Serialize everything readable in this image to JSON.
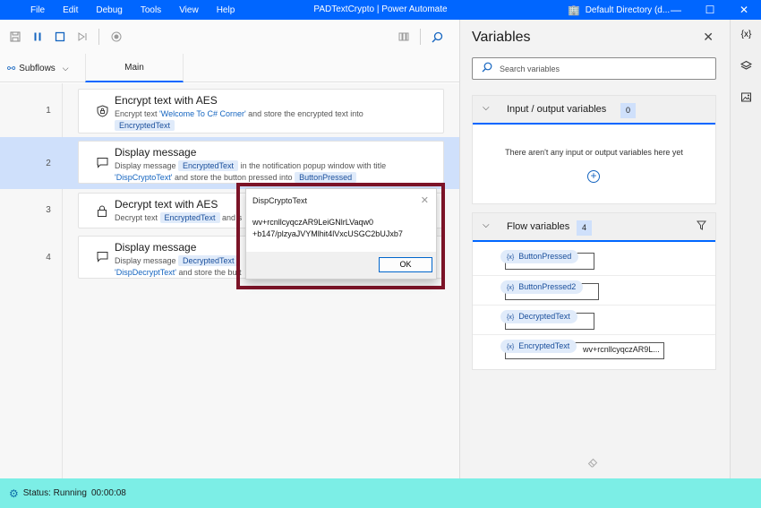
{
  "titlebar": {
    "menu": [
      "File",
      "Edit",
      "Debug",
      "Tools",
      "View",
      "Help"
    ],
    "app_title": "PADTextCrypto | Power Automate",
    "directory": "Default Directory (d...",
    "controls": {
      "minimize": "—",
      "maximize": "☐",
      "close": "✕"
    }
  },
  "toolbar": {
    "save_icon": "save-icon",
    "pause_icon": "pause-icon",
    "stop_icon": "stop-icon",
    "step_icon": "run-next-icon",
    "record_icon": "record-icon",
    "web_icon": "web-recorder-icon",
    "search_icon": "search-icon"
  },
  "tabs": {
    "subflows_label": "Subflows",
    "main_label": "Main"
  },
  "actions": [
    {
      "line": "1",
      "title": "Encrypt text with AES",
      "desc_pre": "Encrypt text ",
      "desc_str": "'Welcome To C# Corner'",
      "desc_mid": " and store the encrypted text into",
      "var": "EncryptedText"
    },
    {
      "line": "2",
      "title": "Display message",
      "desc_pre": "Display message ",
      "var1": "EncryptedText",
      "desc_mid": " in the notification popup window with title",
      "desc_str": "'DispCryptoText'",
      "desc_mid2": " and store the button pressed into ",
      "var2": "ButtonPressed"
    },
    {
      "line": "3",
      "title": "Decrypt text with AES",
      "desc_pre": "Decrypt text ",
      "var1": "EncryptedText",
      "desc_mid": " and s"
    },
    {
      "line": "4",
      "title": "Display message",
      "desc_pre": "Display message ",
      "var1": "DecryptedText",
      "desc_str": "'DispDecryptText'",
      "desc_mid2": " and store the butt"
    }
  ],
  "popup": {
    "title": "DispCryptoText",
    "close": "✕",
    "line1": "wv+rcnllcyqczAR9LeiGNlrLVaqw0",
    "line2": "+b147/plzyaJVYMlhit4lVxcUSGC2bUJxb7",
    "ok_label": "OK"
  },
  "variables_panel": {
    "title": "Variables",
    "close": "✕",
    "search_placeholder": "Search variables",
    "io_section": {
      "title": "Input / output variables",
      "count": "0",
      "empty_message": "There aren't any input or output variables here yet"
    },
    "flow_section": {
      "title": "Flow variables",
      "count": "4",
      "vars": [
        {
          "name": "ButtonPressed",
          "value": ""
        },
        {
          "name": "ButtonPressed2",
          "value": ""
        },
        {
          "name": "DecryptedText",
          "value": ""
        },
        {
          "name": "EncryptedText",
          "value": "wv+rcnllcyqczAR9L..."
        }
      ]
    }
  },
  "rail": {
    "variables_label": "{x}"
  },
  "status": {
    "text": "Status: Running",
    "time": "00:00:08"
  },
  "colors": {
    "titlebar": "#0066ff",
    "status_bar": "#7ceee6",
    "highlight_frame": "#7d1428",
    "row_highlight": "#cfe0fb"
  }
}
